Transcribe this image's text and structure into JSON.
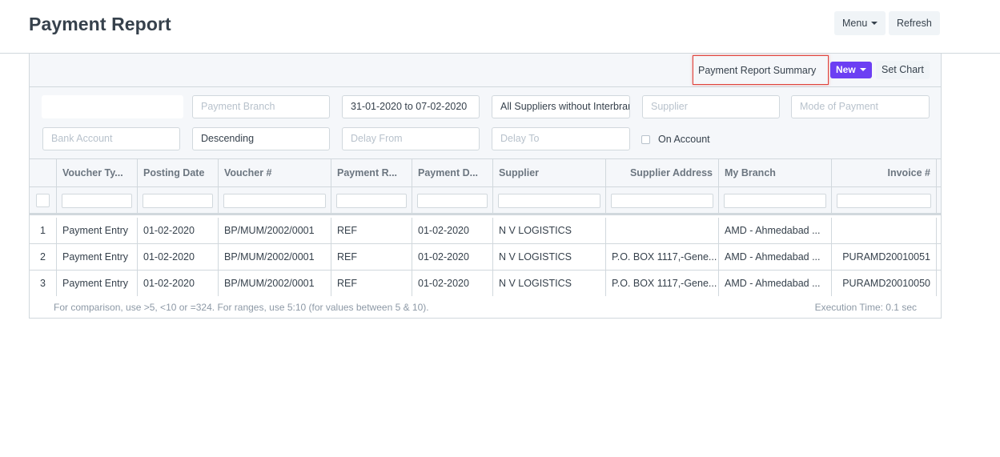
{
  "page": {
    "title": "Payment Report",
    "menu_label": "Menu",
    "refresh_label": "Refresh"
  },
  "toolbar": {
    "summary_label": "Payment Report Summary",
    "new_label": "New",
    "set_chart_label": "Set Chart"
  },
  "filters": {
    "company": {
      "value": "",
      "placeholder": ""
    },
    "payment_branch": {
      "value": "",
      "placeholder": "Payment Branch"
    },
    "date_range": {
      "value": "31-01-2020 to 07-02-2020"
    },
    "supplier_group": {
      "value": "All Suppliers without Interbranch"
    },
    "supplier": {
      "placeholder": "Supplier"
    },
    "mode_of_payment": {
      "placeholder": "Mode of Payment"
    },
    "bank_account": {
      "placeholder": "Bank Account"
    },
    "order": {
      "value": "Descending"
    },
    "delay_from": {
      "placeholder": "Delay From"
    },
    "delay_to": {
      "placeholder": "Delay To"
    },
    "on_account": {
      "label": "On Account",
      "checked": false
    }
  },
  "table": {
    "columns": [
      "Voucher Ty...",
      "Posting Date",
      "Voucher #",
      "Payment R...",
      "Payment D...",
      "Supplier",
      "Supplier Address",
      "My Branch",
      "Invoice #"
    ],
    "rows": [
      {
        "index": "1",
        "voucher_type": "Payment Entry",
        "posting_date": "01-02-2020",
        "voucher_no": "BP/MUM/2002/0001",
        "payment_ref": "REF",
        "payment_date": "01-02-2020",
        "supplier": "N V LOGISTICS",
        "supplier_address": "",
        "my_branch": "AMD - Ahmedabad ...",
        "invoice_no": ""
      },
      {
        "index": "2",
        "voucher_type": "Payment Entry",
        "posting_date": "01-02-2020",
        "voucher_no": "BP/MUM/2002/0001",
        "payment_ref": "REF",
        "payment_date": "01-02-2020",
        "supplier": "N V LOGISTICS",
        "supplier_address": "P.O. BOX 1117,-Gene...",
        "my_branch": "AMD - Ahmedabad ...",
        "invoice_no": "PURAMD20010051"
      },
      {
        "index": "3",
        "voucher_type": "Payment Entry",
        "posting_date": "01-02-2020",
        "voucher_no": "BP/MUM/2002/0001",
        "payment_ref": "REF",
        "payment_date": "01-02-2020",
        "supplier": "N V LOGISTICS",
        "supplier_address": "P.O. BOX 1117,-Gene...",
        "my_branch": "AMD - Ahmedabad ...",
        "invoice_no": "PURAMD20010050"
      }
    ]
  },
  "footer": {
    "hint": "For comparison, use >5, <10 or =324. For ranges, use 5:10 (for values between 5 & 10).",
    "execution_time": "Execution Time: 0.1 sec"
  },
  "colors": {
    "accent": "#6c3ff3",
    "highlight_border": "#e0413a",
    "border": "#d1d8dd"
  }
}
